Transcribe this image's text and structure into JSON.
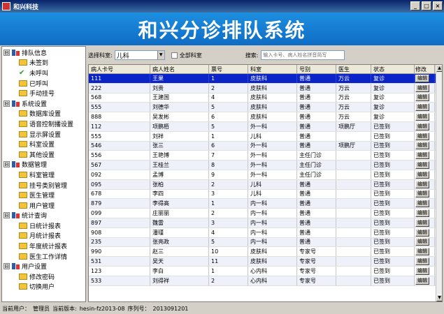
{
  "window": {
    "title": "和兴科技",
    "min": "_",
    "max": "□",
    "close": "×"
  },
  "banner": {
    "title": "和兴分诊排队系统"
  },
  "sidebar": {
    "groups": [
      {
        "label": "排队信息",
        "expander": "⊟",
        "items": [
          "未签到",
          "未呼叫",
          "已呼叫",
          "手动挂号"
        ]
      },
      {
        "label": "系统设置",
        "expander": "⊟",
        "items": [
          "数据库设置",
          "语音控制播设置",
          "显示屏设置",
          "科室设置",
          "其他设置"
        ]
      },
      {
        "label": "数据管理",
        "expander": "⊟",
        "items": [
          "科室管理",
          "挂号类别管理",
          "医生管理",
          "用户管理"
        ]
      },
      {
        "label": "统计查询",
        "expander": "⊟",
        "items": [
          "日统计报表",
          "月统计报表",
          "年度统计报表",
          "医生工作详情"
        ]
      },
      {
        "label": "用户设置",
        "expander": "⊟",
        "items": [
          "修改密码",
          "切换用户"
        ]
      }
    ]
  },
  "filter": {
    "dept_label": "选择科室:",
    "dept_value": "儿科",
    "all_label": "全部科室",
    "search_label": "搜索:",
    "search_placeholder": "输入卡号、病人姓名拼音简写"
  },
  "table": {
    "columns": [
      "病人卡号",
      "病人姓名",
      "票号",
      "科室",
      "号别",
      "医生",
      "状态",
      "修改"
    ],
    "edit_label": "编辑",
    "rows": [
      [
        "111",
        "王果",
        "1",
        "皮肤科",
        "普通",
        "万云",
        "复诊"
      ],
      [
        "222",
        "刘贵",
        "2",
        "皮肤科",
        "普通",
        "万云",
        "复诊"
      ],
      [
        "568",
        "王建国",
        "4",
        "皮肤科",
        "普通",
        "万云",
        "复诊"
      ],
      [
        "555",
        "刘德华",
        "5",
        "皮肤科",
        "普通",
        "万云",
        "复诊"
      ],
      [
        "888",
        "吴发彬",
        "6",
        "皮肤科",
        "普通",
        "万云",
        "复诊"
      ],
      [
        "112",
        "项鹏栢",
        "5",
        "外一科",
        "普通",
        "项鹏厅",
        "已签到"
      ],
      [
        "555",
        "刘祥",
        "1",
        "儿科",
        "普通",
        "",
        "已签到"
      ],
      [
        "546",
        "张三",
        "6",
        "外一科",
        "普通",
        "项鹏厅",
        "已签到"
      ],
      [
        "556",
        "王艳博",
        "7",
        "外一科",
        "主任门诊",
        "",
        "已签到"
      ],
      [
        "567",
        "王桂兰",
        "8",
        "外一科",
        "主任门诊",
        "",
        "已签到"
      ],
      [
        "092",
        "孟博",
        "9",
        "外一科",
        "主任门诊",
        "",
        "已签到"
      ],
      [
        "095",
        "张柏",
        "2",
        "儿科",
        "普通",
        "",
        "已签到"
      ],
      [
        "678",
        "李四",
        "3",
        "儿科",
        "普通",
        "",
        "已签到"
      ],
      [
        "879",
        "李得高",
        "1",
        "内一科",
        "普通",
        "",
        "已签到"
      ],
      [
        "099",
        "庄丽丽",
        "2",
        "内一科",
        "普通",
        "",
        "已签到"
      ],
      [
        "897",
        "魏雷",
        "3",
        "内一科",
        "普通",
        "",
        "已签到"
      ],
      [
        "908",
        "潘瑾",
        "4",
        "内一科",
        "普通",
        "",
        "已签到"
      ],
      [
        "235",
        "张亮政",
        "5",
        "内一科",
        "普通",
        "",
        "已签到"
      ],
      [
        "990",
        "赵三",
        "10",
        "皮肤科",
        "专家号",
        "",
        "已签到"
      ],
      [
        "531",
        "吴天",
        "11",
        "皮肤科",
        "专家号",
        "",
        "已签到"
      ],
      [
        "123",
        "李白",
        "1",
        "心内科",
        "专家号",
        "",
        "已签到"
      ],
      [
        "533",
        "刘得祥",
        "2",
        "心内科",
        "专家号",
        "",
        "已签到"
      ]
    ],
    "selected_row": 0
  },
  "status": {
    "user_label": "当前用户：",
    "user": "管理员",
    "version_label": "当前版本:",
    "version": "hesin-fz2013-08",
    "serial_label": "序列号：",
    "serial": "2013091201"
  },
  "colors": {
    "banner": "#1d8fe0",
    "selected_row": "#0a24c8"
  }
}
